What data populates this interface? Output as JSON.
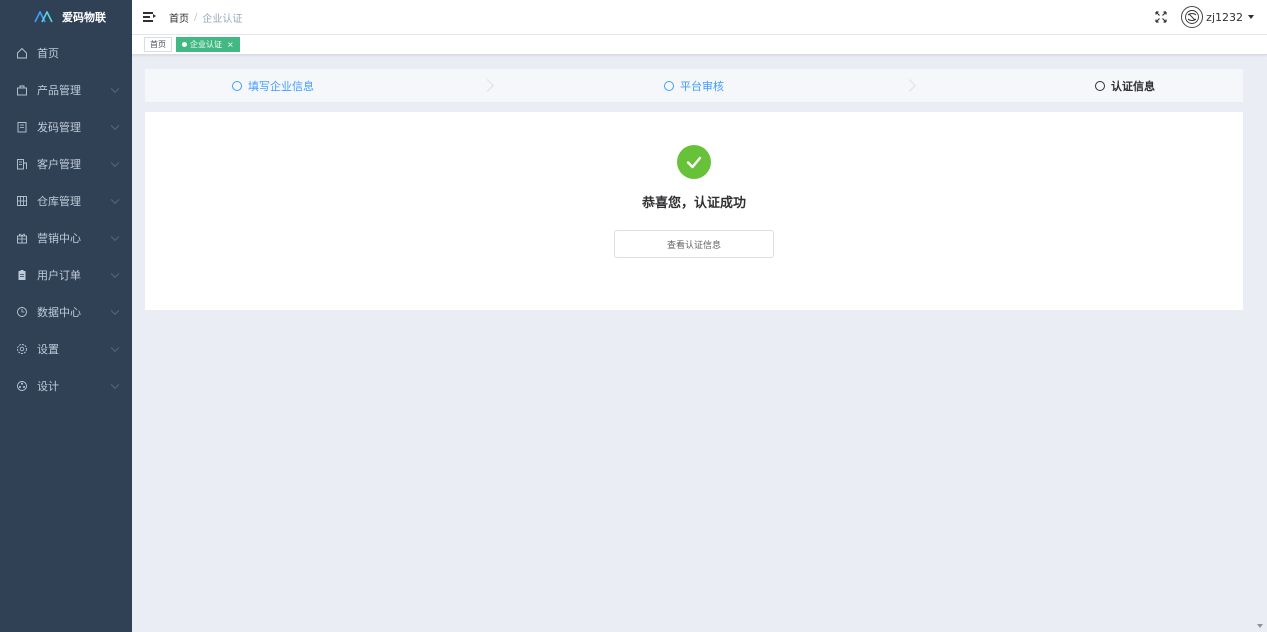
{
  "sidebar": {
    "logo_text": "爱码物联",
    "items": [
      {
        "label": "首页",
        "icon": "home-icon",
        "has_children": false
      },
      {
        "label": "产品管理",
        "icon": "product-icon",
        "has_children": true
      },
      {
        "label": "发码管理",
        "icon": "code-icon",
        "has_children": true
      },
      {
        "label": "客户管理",
        "icon": "customer-icon",
        "has_children": true
      },
      {
        "label": "仓库管理",
        "icon": "warehouse-icon",
        "has_children": true
      },
      {
        "label": "营销中心",
        "icon": "marketing-icon",
        "has_children": true
      },
      {
        "label": "用户订单",
        "icon": "order-icon",
        "has_children": true
      },
      {
        "label": "数据中心",
        "icon": "data-icon",
        "has_children": true
      },
      {
        "label": "设置",
        "icon": "settings-icon",
        "has_children": true
      },
      {
        "label": "设计",
        "icon": "design-icon",
        "has_children": true
      }
    ]
  },
  "header": {
    "breadcrumb": {
      "home": "首页",
      "separator": "/",
      "current": "企业认证"
    },
    "user": {
      "name": "zj1232"
    }
  },
  "tags": [
    {
      "label": "首页",
      "active": false
    },
    {
      "label": "企业认证",
      "active": true,
      "close": "×"
    }
  ],
  "steps": [
    {
      "label": "填写企业信息",
      "state": "done"
    },
    {
      "label": "平台审核",
      "state": "done"
    },
    {
      "label": "认证信息",
      "state": "current"
    }
  ],
  "result": {
    "title": "恭喜您，认证成功",
    "button_label": "查看认证信息"
  },
  "colors": {
    "sidebar_bg": "#304156",
    "accent": "#409eff",
    "success": "#67c23a",
    "tag_active": "#42b983"
  }
}
